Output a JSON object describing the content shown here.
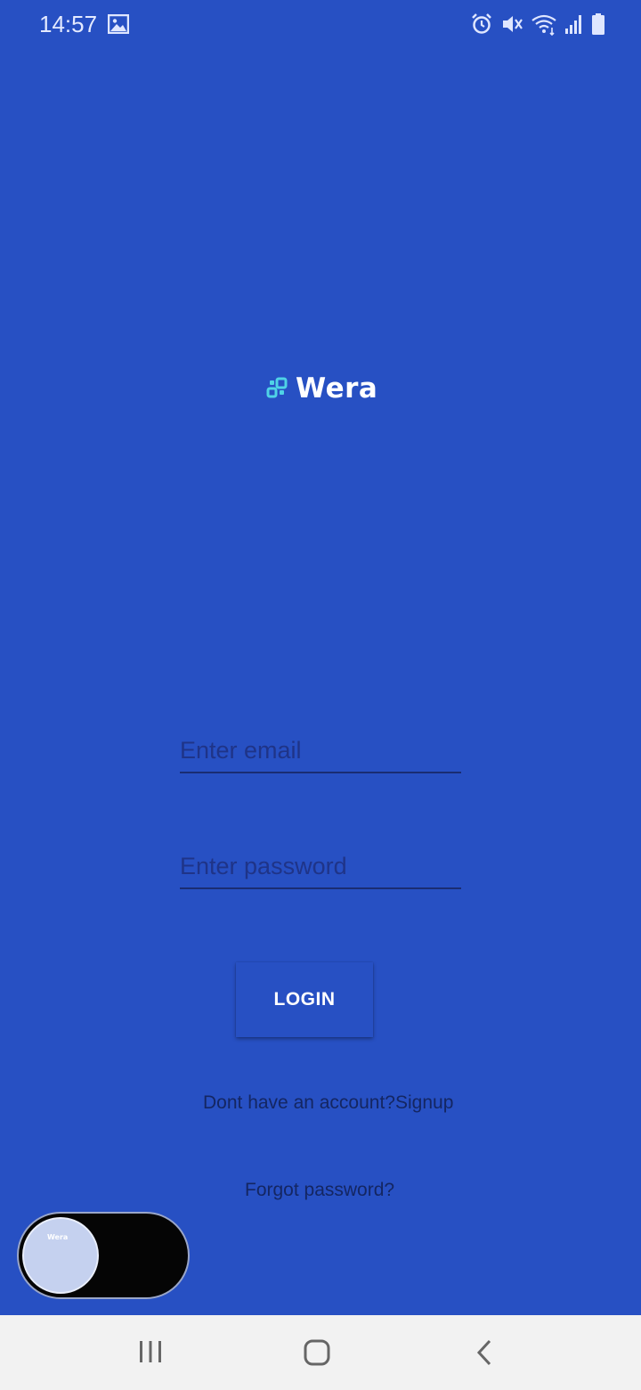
{
  "status_bar": {
    "time": "14:57",
    "icons": [
      "gallery-icon",
      "alarm-icon",
      "mute-icon",
      "wifi-icon",
      "signal-icon",
      "battery-icon"
    ]
  },
  "app": {
    "logo_text": "Wera",
    "logo_icon": "blocks-logo-icon",
    "brand_color": "#2750c3",
    "logo_accent": "#4fd3e6"
  },
  "login_form": {
    "email_placeholder": "Enter email",
    "password_placeholder": "Enter password",
    "login_label": "LOGIN",
    "signup_text": "Dont have an account?Signup",
    "forgot_text": "Forgot password?"
  },
  "theme_toggle": {
    "knob_logo_text": "Wera",
    "state": "off"
  },
  "nav_bar": {
    "icons": [
      "recents-icon",
      "home-icon",
      "back-icon"
    ]
  }
}
